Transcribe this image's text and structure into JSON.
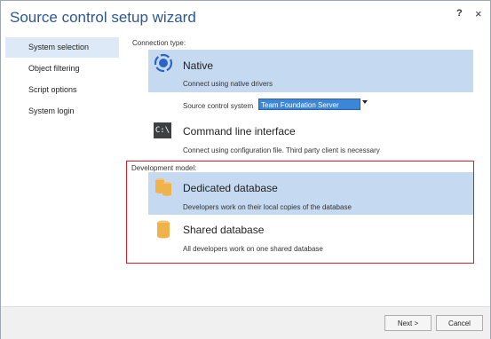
{
  "window": {
    "title": "Source control setup wizard",
    "help_glyph": "?",
    "close_glyph": "×"
  },
  "nav": {
    "items": [
      {
        "label": "System selection",
        "active": true
      },
      {
        "label": "Object filtering",
        "active": false
      },
      {
        "label": "Script options",
        "active": false
      },
      {
        "label": "System login",
        "active": false
      }
    ]
  },
  "connection": {
    "label": "Connection type:",
    "native": {
      "title": "Native",
      "desc": "Connect using native drivers",
      "icon": "native-driver-icon"
    },
    "source_control_label": "Source control system",
    "source_control_value": "Team Foundation Server",
    "cli": {
      "title": "Command line interface",
      "desc": "Connect using configuration file. Third party client is necessary",
      "icon": "command-prompt-icon",
      "icon_text": "C:\\"
    }
  },
  "development": {
    "label": "Development model:",
    "dedicated": {
      "title": "Dedicated database",
      "desc": "Developers work on their local copies of the database",
      "icon": "databases-icon"
    },
    "shared": {
      "title": "Shared database",
      "desc": "All developers work on one shared database",
      "icon": "database-icon"
    }
  },
  "footer": {
    "next_label": "Next >",
    "cancel_label": "Cancel"
  },
  "colors": {
    "accent": "#2b5797",
    "selection": "#c5d9f1",
    "highlight_border": "#d21e2b",
    "db_icon": "#f0b24a"
  }
}
